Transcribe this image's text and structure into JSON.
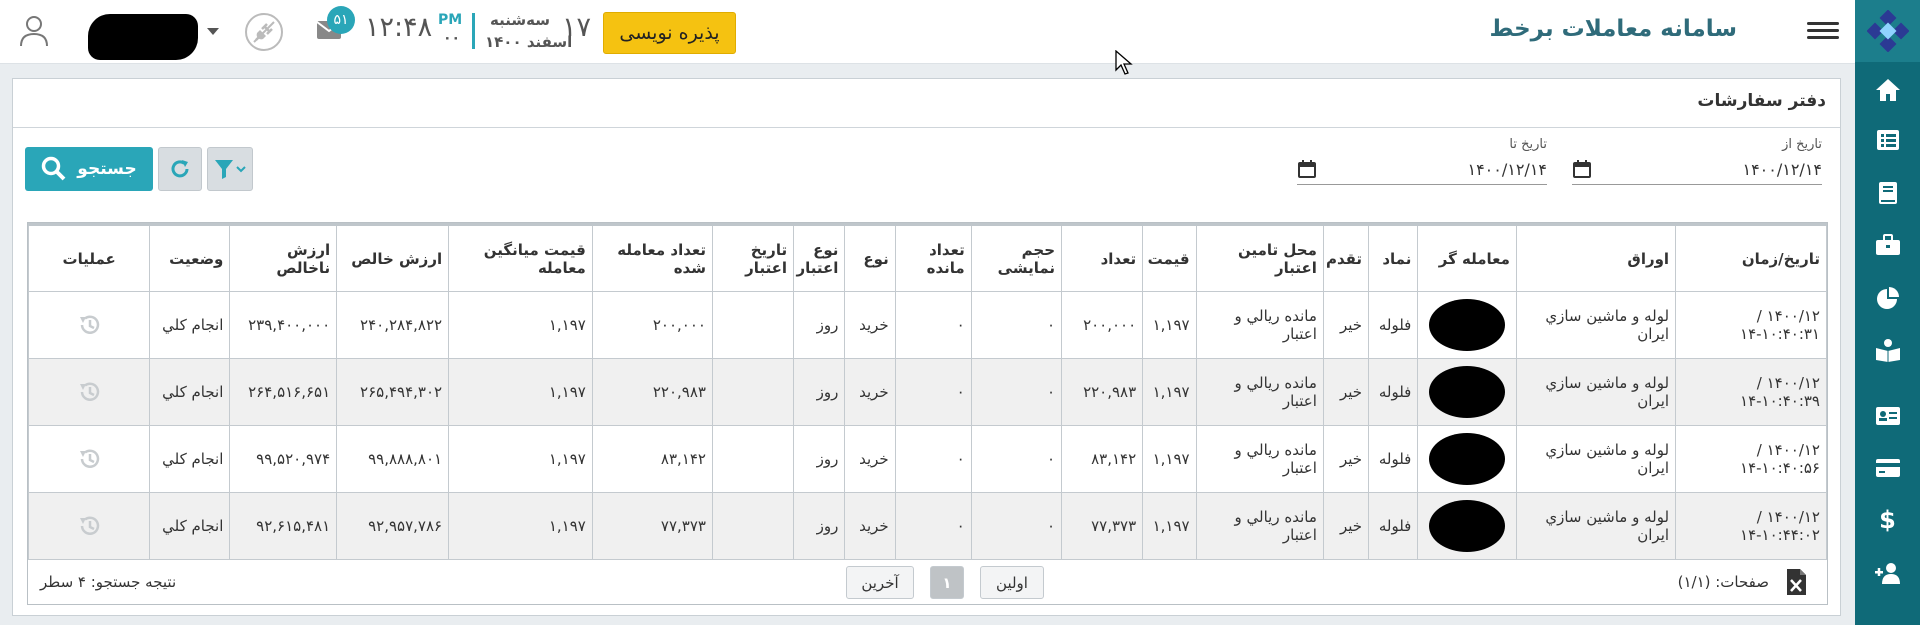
{
  "app": {
    "title": "سامانه معاملات برخط",
    "order_button": "پذیره نویسی",
    "date_day": "۱۷",
    "date_weekday": "سه‌شنبه",
    "date_month_year": "اسفند ۱۴۰۰",
    "time_ampm": "PM",
    "time_seconds": "۰۰",
    "time_main": "۱۲:۴۸",
    "mail_badge": "۵۱"
  },
  "sidebar": {
    "items": [
      "home-icon",
      "list-icon",
      "book-icon",
      "briefcase-icon",
      "pie-chart-icon",
      "reader-icon",
      "id-card-icon",
      "credit-card-icon",
      "dollar-icon",
      "add-user-icon"
    ]
  },
  "panel": {
    "title": "دفتر سفارشات",
    "from_label": "تاریخ از",
    "from_value": "۱۴۰۰/۱۲/۱۴",
    "to_label": "تاریخ تا",
    "to_value": "۱۴۰۰/۱۲/۱۴",
    "search_label": "جستجو"
  },
  "table": {
    "headers": [
      "تاریخ/زمان",
      "اوراق",
      "معامله گر",
      "نماد",
      "تقدم",
      "محل تامین اعتبار",
      "قیمت",
      "تعداد",
      "حجم نمایشی",
      "تعداد مانده",
      "نوع",
      "نوع اعتبار",
      "تاریخ اعتبار",
      "تعداد معامله شده",
      "قیمت میانگین معامله",
      "ارزش خالص",
      "ارزش ناخالص",
      "وضعیت",
      "عملیات"
    ],
    "rows": [
      {
        "datetime": "۱۴۰۰/۱۲ /۱۴-۱۰:۴۰:۳۱",
        "paper": "لوله و ماشين سازي ايران",
        "symbol": "فلوله",
        "priority": "خیر",
        "credit_source": "مانده ريالي و اعتبار",
        "price": "۱,۱۹۷",
        "count": "۲۰۰,۰۰۰",
        "display_volume": "۰",
        "remaining": "۰",
        "type": "خرید",
        "credit_type": "روز",
        "credit_date": "",
        "traded": "۲۰۰,۰۰۰",
        "avg_price": "۱,۱۹۷",
        "net_value": "۲۴۰,۲۸۴,۸۲۲",
        "gross_value": "۲۳۹,۴۰۰,۰۰۰",
        "status": "انجام كلي"
      },
      {
        "datetime": "۱۴۰۰/۱۲ /۱۴-۱۰:۴۰:۳۹",
        "paper": "لوله و ماشين سازي ايران",
        "symbol": "فلوله",
        "priority": "خیر",
        "credit_source": "مانده ريالي و اعتبار",
        "price": "۱,۱۹۷",
        "count": "۲۲۰,۹۸۳",
        "display_volume": "۰",
        "remaining": "۰",
        "type": "خرید",
        "credit_type": "روز",
        "credit_date": "",
        "traded": "۲۲۰,۹۸۳",
        "avg_price": "۱,۱۹۷",
        "net_value": "۲۶۵,۴۹۴,۳۰۲",
        "gross_value": "۲۶۴,۵۱۶,۶۵۱",
        "status": "انجام كلي"
      },
      {
        "datetime": "۱۴۰۰/۱۲ /۱۴-۱۰:۴۰:۵۶",
        "paper": "لوله و ماشين سازي ايران",
        "symbol": "فلوله",
        "priority": "خیر",
        "credit_source": "مانده ريالي و اعتبار",
        "price": "۱,۱۹۷",
        "count": "۸۳,۱۴۲",
        "display_volume": "۰",
        "remaining": "۰",
        "type": "خرید",
        "credit_type": "روز",
        "credit_date": "",
        "traded": "۸۳,۱۴۲",
        "avg_price": "۱,۱۹۷",
        "net_value": "۹۹,۸۸۸,۸۰۱",
        "gross_value": "۹۹,۵۲۰,۹۷۴",
        "status": "انجام كلي"
      },
      {
        "datetime": "۱۴۰۰/۱۲ /۱۴-۱۰:۴۴:۰۲",
        "paper": "لوله و ماشين سازي ايران",
        "symbol": "فلوله",
        "priority": "خیر",
        "credit_source": "مانده ريالي و اعتبار",
        "price": "۱,۱۹۷",
        "count": "۷۷,۳۷۳",
        "display_volume": "۰",
        "remaining": "۰",
        "type": "خرید",
        "credit_type": "روز",
        "credit_date": "",
        "traded": "۷۷,۳۷۳",
        "avg_price": "۱,۱۹۷",
        "net_value": "۹۲,۹۵۷,۷۸۶",
        "gross_value": "۹۲,۶۱۵,۴۸۱",
        "status": "انجام كلي"
      }
    ],
    "footer": {
      "pages_label": "صفحات: (۱/۱)",
      "first_label": "اولین",
      "current_page": "۱",
      "last_label": "آخرین",
      "result_label": "نتیجه جستجو: ۴ سطر"
    }
  },
  "colors": {
    "sidebar": "#0f6a78",
    "accent": "#2aa6b8",
    "order_button": "#f5c211"
  }
}
